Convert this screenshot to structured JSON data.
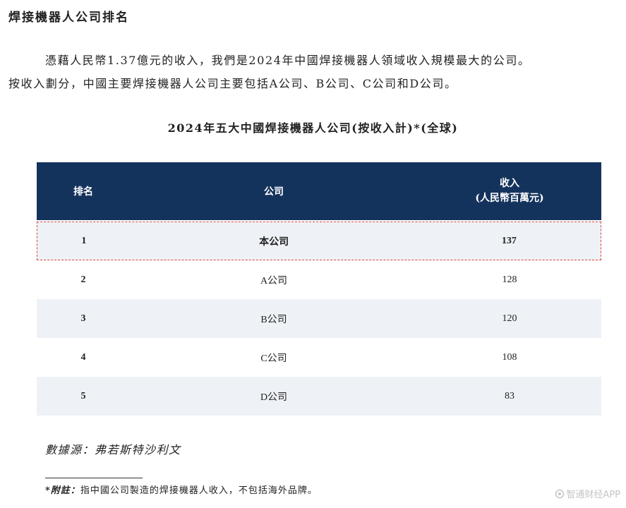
{
  "heading": "焊接機器人公司排名",
  "paragraph_line1": "憑藉人民幣1.37億元的收入，我們是2024年中國焊接機器人領域收入規模最大的公司。",
  "paragraph_line2": "按收入劃分，中國主要焊接機器人公司主要包括A公司、B公司、C公司和D公司。",
  "table": {
    "title": "2024年五大中國焊接機器人公司(按收入計)*(全球)",
    "headers": {
      "rank": "排名",
      "company": "公司",
      "revenue_line1": "收入",
      "revenue_line2": "(人民幣百萬元)"
    },
    "rows": [
      {
        "rank": "1",
        "company": "本公司",
        "revenue": "137"
      },
      {
        "rank": "2",
        "company": "A公司",
        "revenue": "128"
      },
      {
        "rank": "3",
        "company": "B公司",
        "revenue": "120"
      },
      {
        "rank": "4",
        "company": "C公司",
        "revenue": "108"
      },
      {
        "rank": "5",
        "company": "D公司",
        "revenue": "83"
      }
    ],
    "header_color": "#14335c",
    "highlight_border_color": "#d9453e"
  },
  "source": "數據源：弗若斯特沙利文",
  "note": {
    "label": "*附註：",
    "text": "指中國公司製造的焊接機器人收入，不包括海外品牌。"
  },
  "watermark": "智通财经APP"
}
